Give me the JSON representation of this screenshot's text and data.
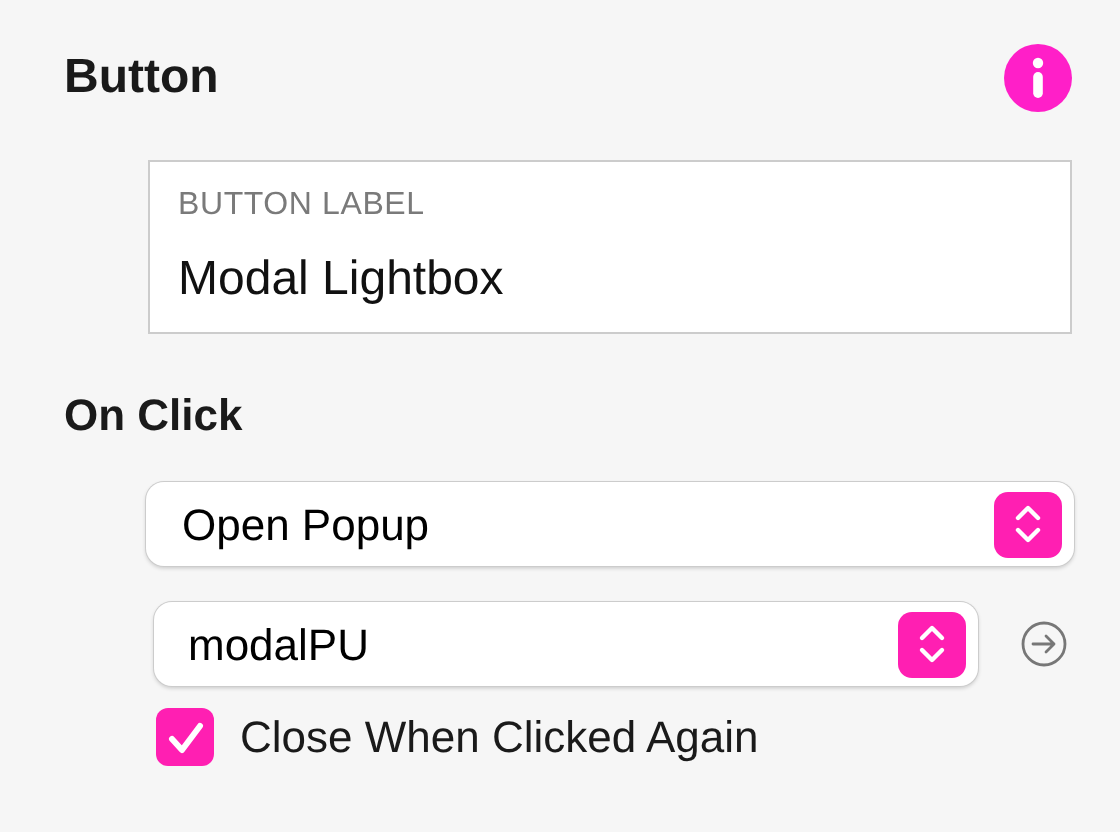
{
  "section_title": "Button",
  "label_field": {
    "label": "BUTTON LABEL",
    "value": "Modal Lightbox"
  },
  "on_click": {
    "title": "On Click",
    "action_select": {
      "value": "Open Popup"
    },
    "target_select": {
      "value": "modalPU"
    },
    "close_again": {
      "label": "Close When Clicked Again",
      "checked": true
    }
  }
}
